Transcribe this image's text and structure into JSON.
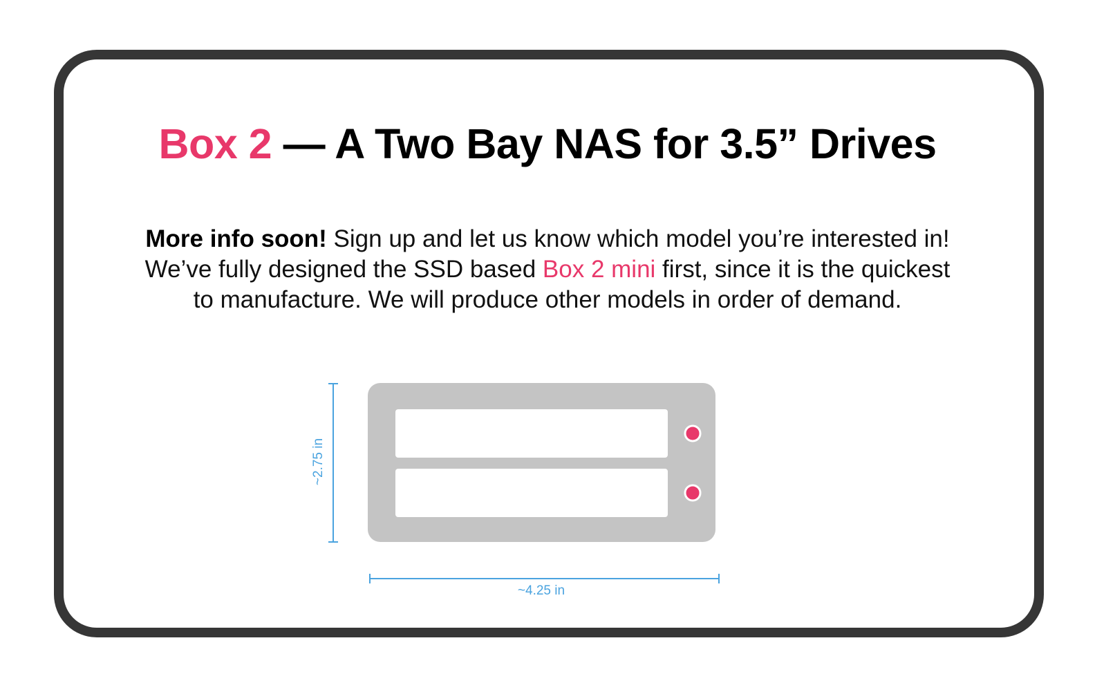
{
  "title": {
    "accent": "Box 2",
    "rest": " — A Two Bay NAS for 3.5” Drives"
  },
  "description": {
    "lead": "More info soon!",
    "line1_rest": " Sign up and let us know which model you’re interested in!",
    "line2_before": "We’ve fully designed the SSD based ",
    "line2_link": "Box 2 mini",
    "line2_after": " first, since it is the quickest",
    "line3": "to manufacture. We will produce other models in order of demand."
  },
  "diagram": {
    "height_label": "~2.75 in",
    "width_label": "~4.25 in",
    "bays": 2
  },
  "colors": {
    "accent": "#e8386a",
    "dimension": "#4aa3df",
    "chassis": "#c4c4c4",
    "border": "#363636"
  }
}
